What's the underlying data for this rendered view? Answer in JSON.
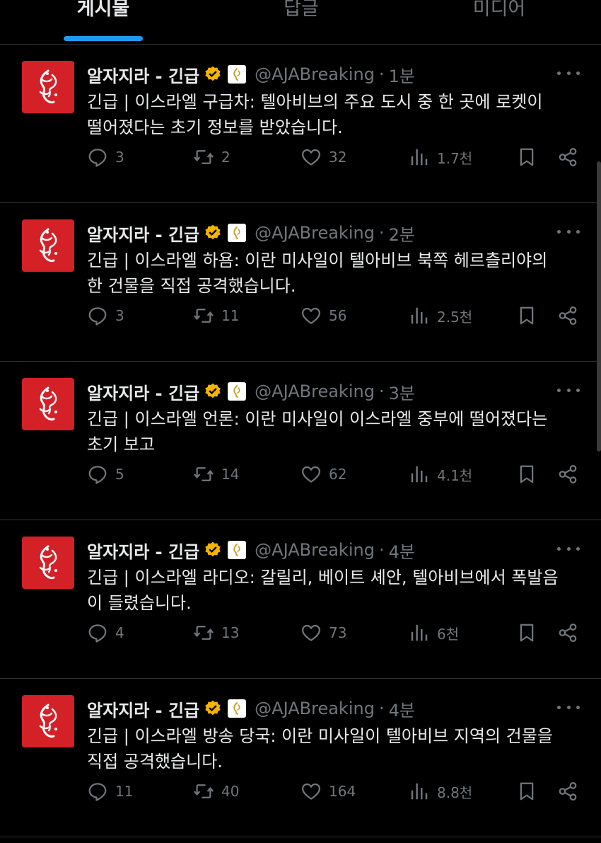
{
  "tabs": [
    "게시물",
    "답글",
    "미디어"
  ],
  "posts": [
    {
      "name": "알자지라 - 긴급",
      "handle": "@AJABreaking",
      "sep": "·",
      "time": "1분",
      "line1": "긴급 | 이스라엘 구급차: 텔아비브의 주요 도시 중 한 곳에 로켓이",
      "line2": "떨어졌다는 초기 정보를 받았습니다.",
      "replies": "3",
      "reposts": "2",
      "likes": "32",
      "views": "1.7천"
    },
    {
      "name": "알자지라 - 긴급",
      "handle": "@AJABreaking",
      "sep": "·",
      "time": "2분",
      "line1": "긴급 | 이스라엘 하욤: 이란 미사일이 텔아비브 북쪽 헤르츨리야의",
      "line2": "한 건물을 직접 공격했습니다.",
      "replies": "3",
      "reposts": "11",
      "likes": "56",
      "views": "2.5천"
    },
    {
      "name": "알자지라 - 긴급",
      "handle": "@AJABreaking",
      "sep": "·",
      "time": "3분",
      "line1": "긴급 | 이스라엘 언론: 이란 미사일이 이스라엘 중부에 떨어졌다는",
      "line2": "초기 보고",
      "replies": "5",
      "reposts": "14",
      "likes": "62",
      "views": "4.1천"
    },
    {
      "name": "알자지라 - 긴급",
      "handle": "@AJABreaking",
      "sep": "·",
      "time": "4분",
      "line1": "긴급 | 이스라엘 라디오: 갈릴리, 베이트 셰안, 텔아비브에서 폭발음",
      "line2": "이 들렸습니다.",
      "replies": "4",
      "reposts": "13",
      "likes": "73",
      "views": "6천"
    },
    {
      "name": "알자지라 - 긴급",
      "handle": "@AJABreaking",
      "sep": "·",
      "time": "4분",
      "line1": "긴급 | 이스라엘 방송 당국: 이란 미사일이 텔아비브 지역의 건물을",
      "line2": "직접 공격했습니다.",
      "replies": "11",
      "reposts": "40",
      "likes": "164",
      "views": "8.8천"
    }
  ],
  "colors": {
    "background": "#000000",
    "text": "#e7e9ea",
    "muted": "#71767b",
    "accent": "#1d9bf0",
    "verified": "#f4b400",
    "avatar": "#d42027",
    "divider": "#2f3336"
  },
  "icons": {
    "avatar": "al-jazeera-logo",
    "verified": "verified-gold-badge",
    "affiliation": "affiliate-logo-badge",
    "more": "more-icon",
    "reply": "reply-icon",
    "repost": "repost-icon",
    "like": "heart-icon",
    "views": "views-icon",
    "bookmark": "bookmark-icon",
    "share": "share-icon"
  }
}
